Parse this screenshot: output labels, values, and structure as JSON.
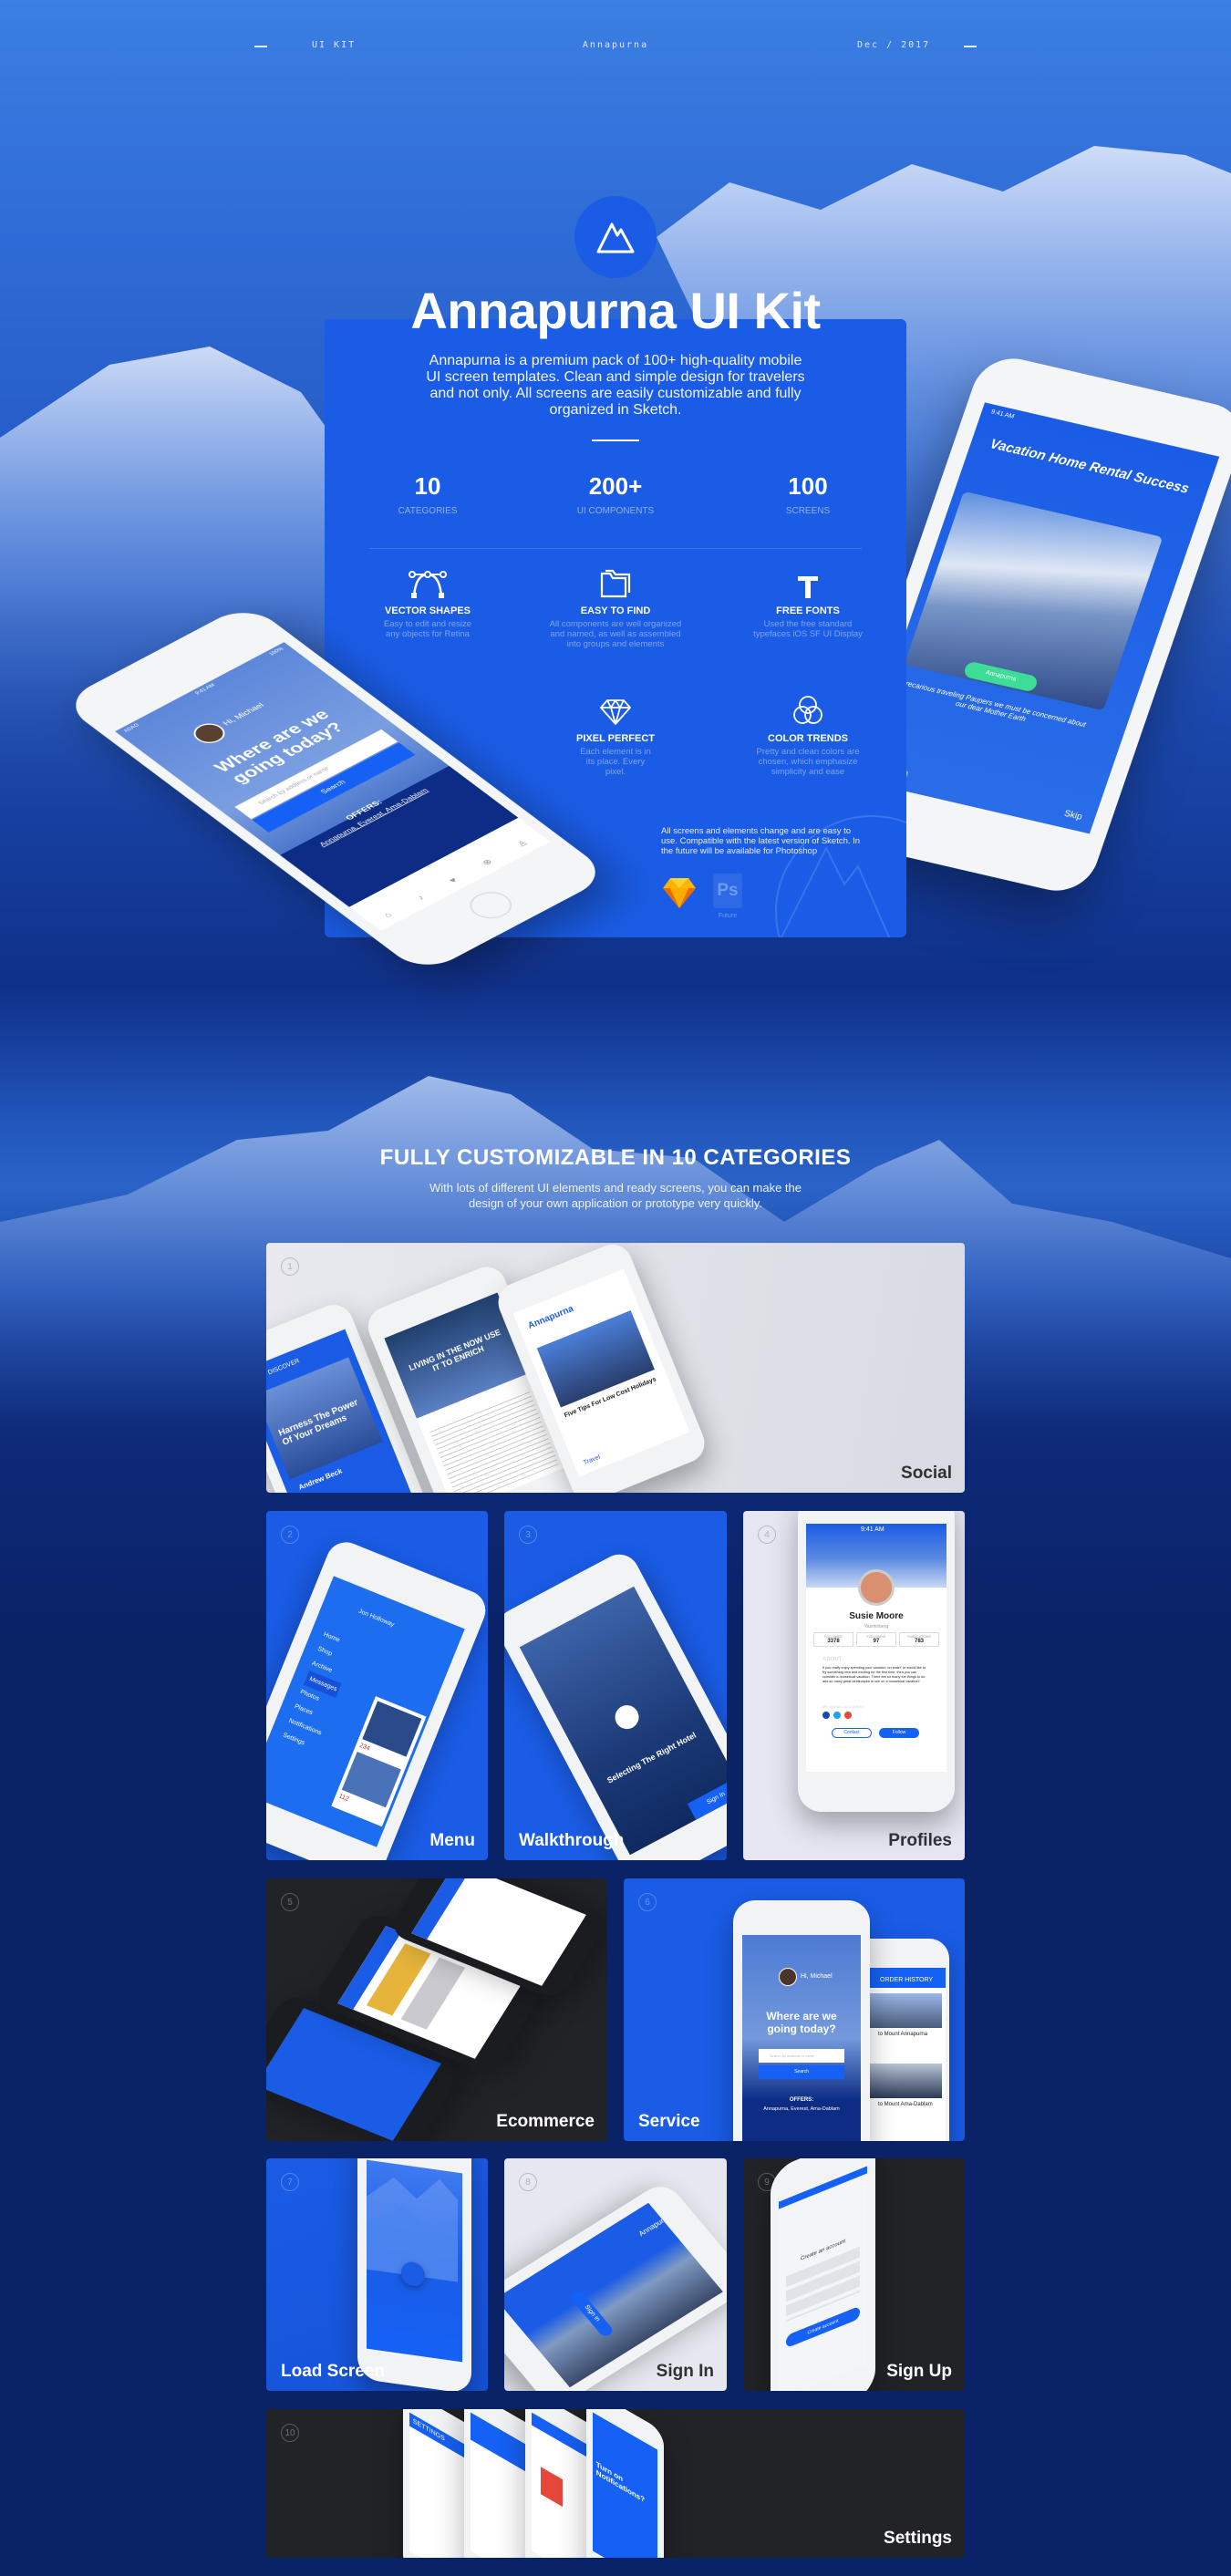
{
  "header": {
    "left": "UI KIT",
    "center": "Annapurna",
    "right": "Dec / 2017"
  },
  "hero": {
    "title": "Annapurna UI Kit",
    "description": "Annapurna is a premium pack of 100+ high-quality mobile UI screen templates. Clean and simple design for travelers and not only. All screens are easily customizable and fully organized in Sketch.",
    "stats": [
      {
        "value": "10",
        "label": "CATEGORIES"
      },
      {
        "value": "200+",
        "label": "UI COMPONENTS"
      },
      {
        "value": "100",
        "label": "SCREENS"
      }
    ],
    "features": [
      {
        "icon": "vector-bezier-icon",
        "title": "VECTOR SHAPES",
        "desc": "Easy to edit and resize any objects for Retina"
      },
      {
        "icon": "folder-icon",
        "title": "EASY TO FIND",
        "desc": "All components are well organized and named, as well as assembled into groups and elements"
      },
      {
        "icon": "type-icon",
        "title": "FREE FONTS",
        "desc": "Used the free standard typefaces iOS SF UI Display"
      },
      {
        "icon": "diamond-icon",
        "title": "PIXEL PERFECT",
        "desc": "Each element is in its place. Every pixel."
      },
      {
        "icon": "color-circles-icon",
        "title": "COLOR TRENDS",
        "desc": "Pretty and clean colors are chosen, which emphasize simplicity and ease"
      }
    ],
    "note": "All screens and elements change and are easy to use. Compatible with the latest version of Sketch. In the future will be available for Photoshop",
    "ps_label": "Ps",
    "future_label": "Future",
    "left_phone": {
      "time": "9:41 AM",
      "battery": "100%",
      "carrier": "ASAG",
      "greeting": "Hi, Michael",
      "headline": "Where are we going today?",
      "search_placeholder": "Search by address or name",
      "search_button": "Search",
      "offers_label": "OFFERS:",
      "offers": "Annapurna, Everest, Ama-Dablam"
    },
    "right_phone": {
      "time": "9:41 AM",
      "headline": "Vacation Home Rental Success",
      "button": "Annapurna",
      "text": "Precarious traveling Paupers we must be concerned about our dear Mother Earth",
      "skip": "Skip"
    }
  },
  "section": {
    "title": "FULLY CUSTOMIZABLE IN 10 CATEGORIES",
    "subtitle": "With lots of different UI elements and ready screens, you can make the design of your own application or prototype very quickly."
  },
  "tiles": [
    {
      "number": "1",
      "label": "Social",
      "screens": {
        "discover": "DISCOVER",
        "card_title": "Harness The Power Of Your Dreams",
        "author": "Andrew Beck",
        "hero_title": "LIVING IN THE NOW USE IT TO ENRICH",
        "brand": "Annapurna",
        "post_title": "Five Tips For Low Cost Holidays",
        "tab": "Travel"
      }
    },
    {
      "number": "2",
      "label": "Menu",
      "screens": {
        "user": "Jon Holloway",
        "items": [
          "Home",
          "Shop",
          "Archive",
          "Messages",
          "Photos",
          "Places",
          "Notifications",
          "Settings"
        ],
        "likes1": "234",
        "likes2": "112"
      }
    },
    {
      "number": "3",
      "label": "Walkthrough",
      "screens": {
        "title": "Selecting The Right Hotel",
        "button": "Sign In"
      }
    },
    {
      "number": "4",
      "label": "Profiles",
      "screens": {
        "time": "9:41 AM",
        "name": "Susie Moore",
        "location": "Yasminberg",
        "stats": [
          {
            "label": "FOLLOWER",
            "value": "3378"
          },
          {
            "label": "FOLLOWING",
            "value": "97"
          },
          {
            "label": "PUBLICATIONS",
            "value": "783"
          }
        ],
        "about_label": "ABOUT",
        "about": "If you really enjoy spending your vacation 'on water' or would like to try something new and exciting for the first time, then you can consider a houseboat vacation. There are so many fun things to do and so many great landscapes to see on a houseboat vacation!",
        "social_label": "MY SOCIAL ACCOUNTS",
        "contact": "Contact",
        "follow": "Follow"
      }
    },
    {
      "number": "5",
      "label": "Ecommerce"
    },
    {
      "number": "6",
      "label": "Service",
      "screens": {
        "greeting": "Hi, Michael",
        "headline": "Where are we going today?",
        "search_placeholder": "Search by address or name",
        "search_button": "Search",
        "offers_label": "OFFERS:",
        "offers": "Annapurna, Everest, Ama-Dablam",
        "order_history": "ORDER HISTORY",
        "trip1": "to Mount Annapurna",
        "trip2": "to Mount Ama-Dablam"
      }
    },
    {
      "number": "7",
      "label": "Load Screen"
    },
    {
      "number": "8",
      "label": "Sign In",
      "screens": {
        "brand": "Annapurna",
        "button": "Sign in"
      }
    },
    {
      "number": "9",
      "label": "Sign Up",
      "screens": {
        "title": "Create an account",
        "button": "Create account"
      }
    },
    {
      "number": "10",
      "label": "Settings",
      "screens": {
        "title": "SETTINGS",
        "question": "Turn on Notifications?"
      }
    }
  ],
  "colors": {
    "brand_blue": "#1a5ce6",
    "navy": "#0a2266",
    "tile_light": "#e5e6ee",
    "tile_dark": "#222327",
    "sketch": "#fdb300",
    "green": "#3ddc97"
  }
}
